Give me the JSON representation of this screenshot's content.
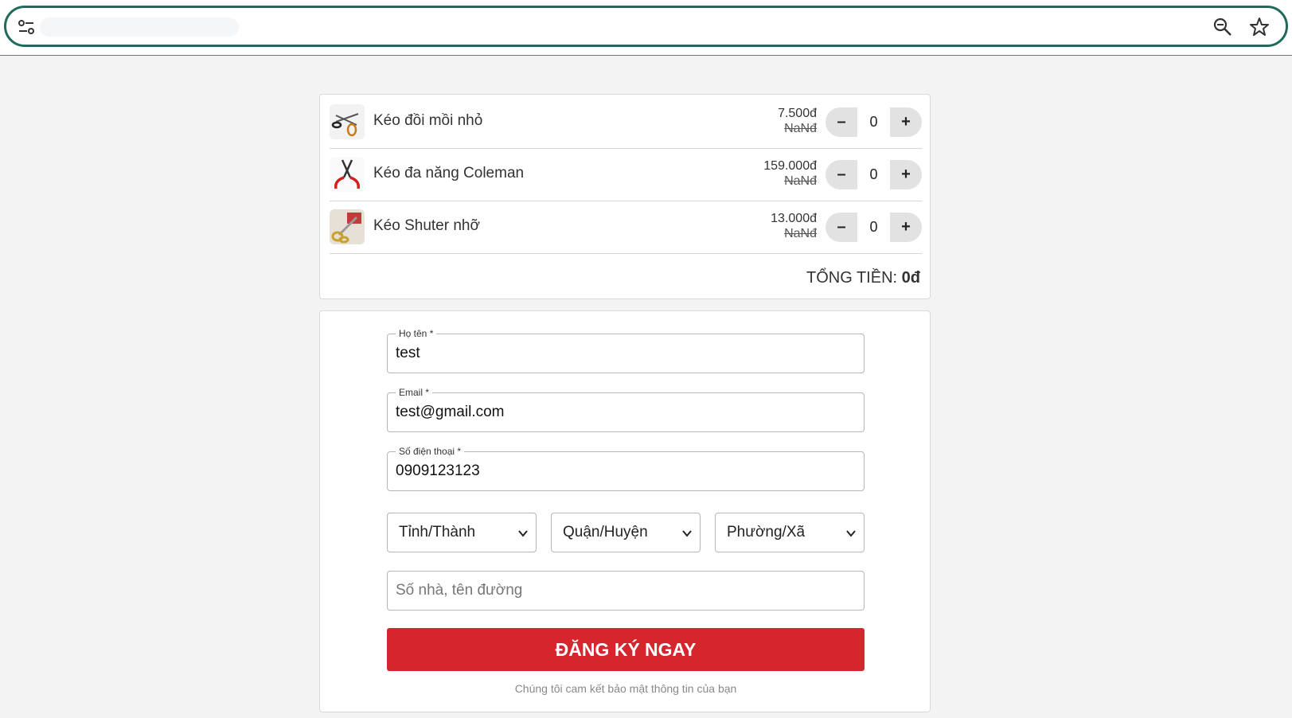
{
  "browser": {
    "icons": {
      "tune": "tune-icon",
      "zoom": "zoom-icon",
      "star": "star-icon"
    }
  },
  "cart": {
    "items": [
      {
        "name": "Kéo đồi mồi nhỏ",
        "price": "7.500đ",
        "old_price": "NaNđ",
        "qty": "0",
        "thumb": "scissors-small-thumb"
      },
      {
        "name": "Kéo đa năng Coleman",
        "price": "159.000đ",
        "old_price": "NaNđ",
        "qty": "0",
        "thumb": "scissors-red-thumb"
      },
      {
        "name": "Kéo Shuter nhỡ",
        "price": "13.000đ",
        "old_price": "NaNđ",
        "qty": "0",
        "thumb": "scissors-gold-thumb"
      }
    ],
    "minus_label": "–",
    "plus_label": "+",
    "total_label": "TỔNG TIỀN:",
    "total_value": "0đ"
  },
  "form": {
    "name": {
      "label": "Họ tên *",
      "value": "test"
    },
    "email": {
      "label": "Email *",
      "value": "test@gmail.com"
    },
    "phone": {
      "label": "Số điện thoại *",
      "value": "0909123123"
    },
    "province": "Tỉnh/Thành",
    "district": "Quận/Huyện",
    "ward": "Phường/Xã",
    "address_placeholder": "Số nhà, tên đường",
    "submit_label": "ĐĂNG KÝ NGAY",
    "note": "Chúng tôi cam kết bảo mật thông tin của bạn"
  },
  "colors": {
    "accent": "#d4262c",
    "omnibox_border": "#1e6b5c"
  }
}
